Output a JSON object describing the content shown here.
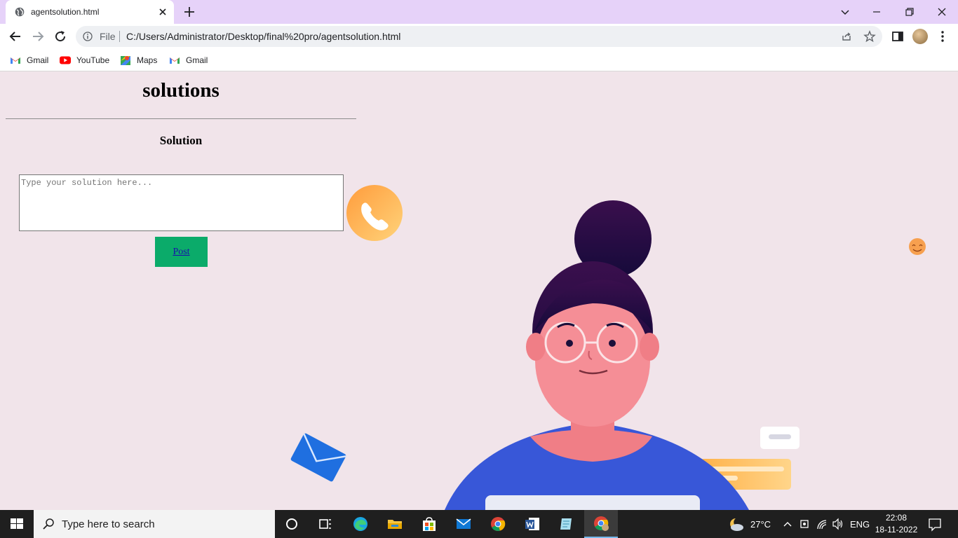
{
  "browser": {
    "tab_title": "agentsolution.html",
    "address_scheme_label": "File",
    "address_url": "C:/Users/Administrator/Desktop/final%20pro/agentsolution.html",
    "bookmarks": [
      {
        "label": "Gmail",
        "icon": "gmail-icon"
      },
      {
        "label": "YouTube",
        "icon": "youtube-icon"
      },
      {
        "label": "Maps",
        "icon": "maps-icon"
      },
      {
        "label": "Gmail",
        "icon": "gmail-icon"
      }
    ]
  },
  "page": {
    "title": "solutions",
    "section_heading": "Solution",
    "solution_placeholder": "Type your solution here...",
    "post_label": "Post"
  },
  "taskbar": {
    "search_placeholder": "Type here to search",
    "weather": "27°C",
    "language": "ENG",
    "time": "22:08",
    "date": "18-11-2022",
    "apps": [
      "task-view",
      "widgets",
      "edge",
      "file-explorer",
      "store",
      "mail",
      "chrome",
      "word",
      "notepad",
      "chrome-profile"
    ]
  },
  "colors": {
    "page_background": "#f1e4ea",
    "post_button": "#0bab6a",
    "tab_strip": "#e6d2f9",
    "taskbar": "#1f1f1f"
  }
}
